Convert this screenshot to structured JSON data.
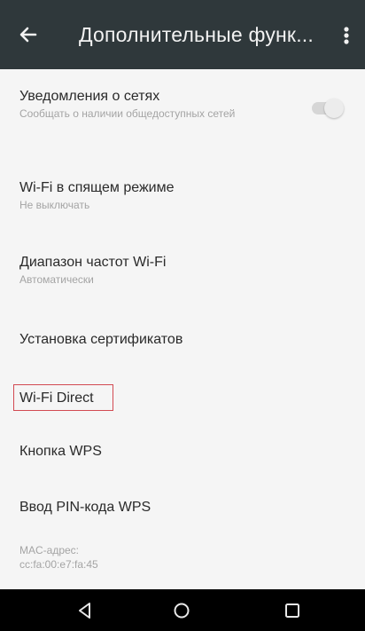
{
  "appbar": {
    "title": "Дополнительные функ...",
    "back_icon": "arrow-back-icon",
    "menu_icon": "more-vert-icon"
  },
  "settings": {
    "network_notifications": {
      "title": "Уведомления о сетях",
      "summary": "Сообщать о наличии общедоступных сетей",
      "toggle_state": "off"
    },
    "wifi_sleep": {
      "title": "Wi-Fi в спящем режиме",
      "summary": "Не выключать"
    },
    "wifi_band": {
      "title": "Диапазон частот Wi-Fi",
      "summary": "Автоматически"
    },
    "certificates": {
      "title": "Установка сертификатов"
    },
    "wifi_direct": {
      "title": "Wi-Fi Direct",
      "highlight_color": "#d24a52"
    },
    "wps_button": {
      "title": "Кнопка WPS"
    },
    "wps_pin": {
      "title": "Ввод PIN-кода WPS"
    },
    "mac": {
      "label": "MAC-адрес:",
      "value": "cc:fa:00:e7:fa:45"
    }
  },
  "navbar": {
    "back_icon": "nav-back-icon",
    "home_icon": "nav-home-icon",
    "recents_icon": "nav-recents-icon"
  },
  "colors": {
    "appbar": "#2f383b",
    "background": "#f5f5f5",
    "navbar": "#000000"
  }
}
